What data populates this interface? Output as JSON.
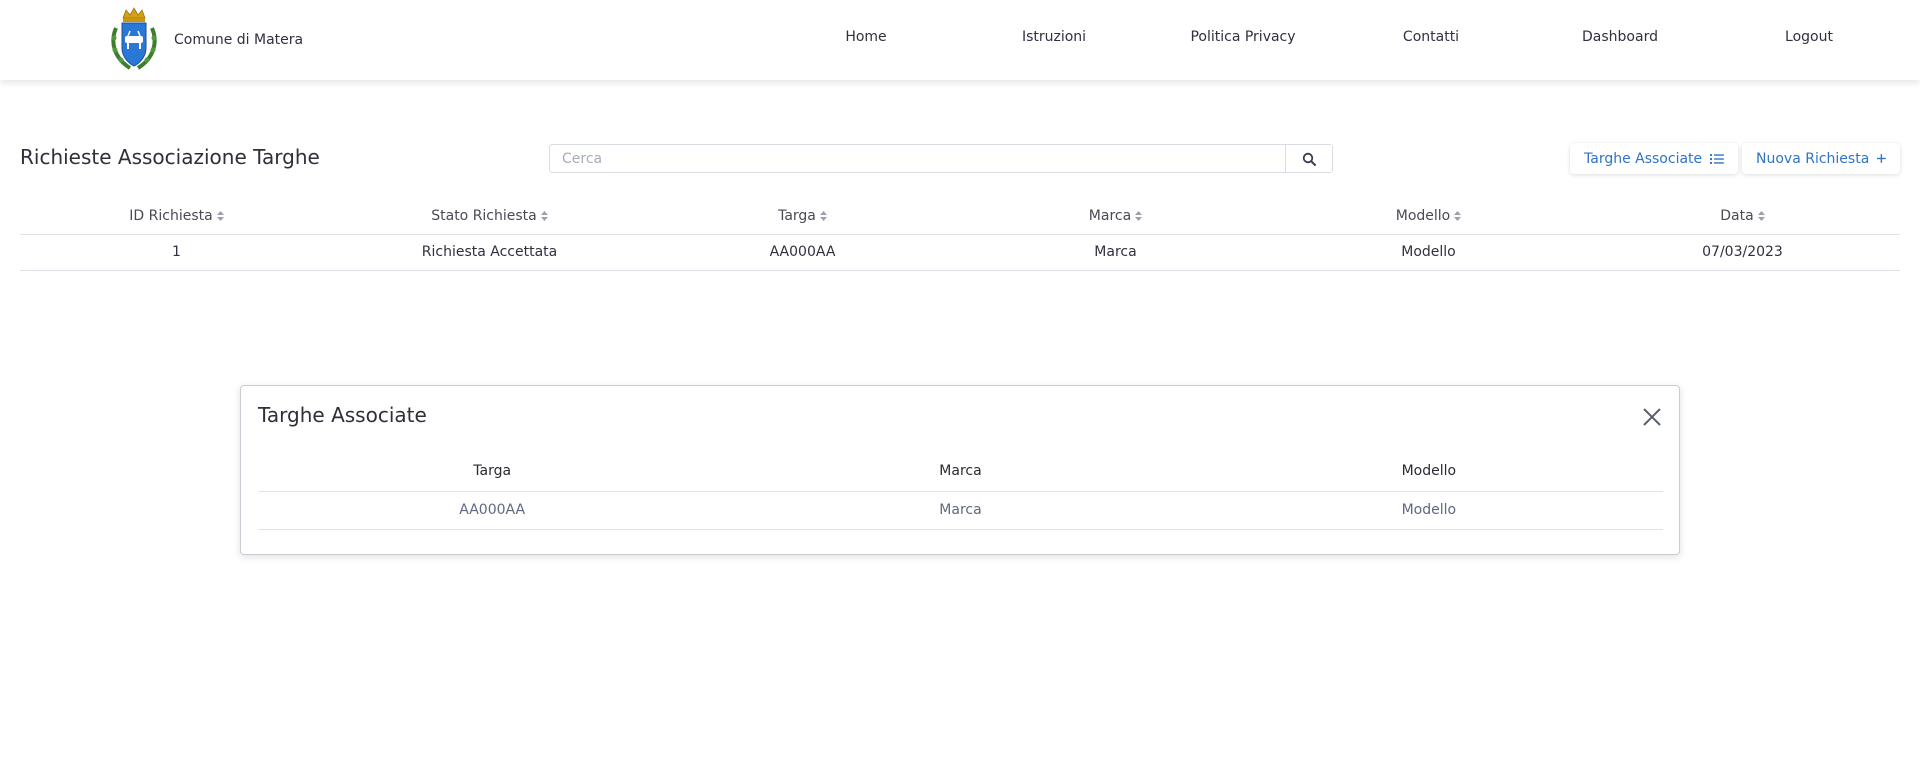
{
  "header": {
    "brand_name": "Comune di Matera",
    "nav": [
      {
        "label": "Home"
      },
      {
        "label": "Istruzioni"
      },
      {
        "label": "Politica Privacy"
      },
      {
        "label": "Contatti"
      },
      {
        "label": "Dashboard"
      },
      {
        "label": "Logout"
      }
    ]
  },
  "page": {
    "title": "Richieste Associazione Targhe",
    "search": {
      "placeholder": "Cerca",
      "value": ""
    },
    "buttons": {
      "targhe_associate": "Targhe Associate",
      "nuova_richiesta": "Nuova Richiesta"
    }
  },
  "requests_table": {
    "columns": [
      "ID Richiesta",
      "Stato Richiesta",
      "Targa",
      "Marca",
      "Modello",
      "Data"
    ],
    "rows": [
      {
        "id": "1",
        "stato": "Richiesta Accettata",
        "targa": "AA000AA",
        "marca": "Marca",
        "modello": "Modello",
        "data": "07/03/2023"
      }
    ]
  },
  "modal": {
    "title": "Targhe Associate",
    "columns": [
      "Targa",
      "Marca",
      "Modello"
    ],
    "rows": [
      {
        "targa": "AA000AA",
        "marca": "Marca",
        "modello": "Modello"
      }
    ]
  },
  "colors": {
    "accent": "#2f74c8",
    "status_accepted": "#2dbb5d",
    "crest_blue": "#2a78d6",
    "crest_gold": "#d4a017",
    "laurel_green": "#3e7d2f"
  },
  "icons": {
    "crest": "matera-crest-icon",
    "search": "search-icon",
    "list": "list-icon",
    "plus": "plus-icon",
    "sort": "sort-icon",
    "close": "close-icon"
  }
}
